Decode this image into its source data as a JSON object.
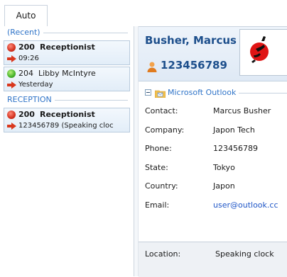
{
  "tabs": [
    {
      "label": "Auto"
    }
  ],
  "call_list": {
    "groups": [
      {
        "label": "(Recent)",
        "calls": [
          {
            "ext": "200",
            "name": "Receptionist",
            "detail": "09:26",
            "status": "busy"
          },
          {
            "ext": "204",
            "name": "Libby McIntyre",
            "detail": "Yesterday",
            "status": "available"
          }
        ]
      },
      {
        "label": "RECEPTION",
        "calls": [
          {
            "ext": "200",
            "name": "Receptionist",
            "detail": "123456789 (Speaking cloc",
            "status": "busy"
          }
        ]
      }
    ]
  },
  "contact_card": {
    "name": "Busher, Marcus",
    "number": "123456789",
    "source_label": "Microsoft Outlook",
    "fields": [
      {
        "key": "Contact:",
        "value": "Marcus Busher"
      },
      {
        "key": "Company:",
        "value": "Japon Tech"
      },
      {
        "key": "Phone:",
        "value": "123456789"
      },
      {
        "key": "State:",
        "value": "Tokyo"
      },
      {
        "key": "Country:",
        "value": "Japon"
      },
      {
        "key": "Email:",
        "value": "user@outlook.cc"
      }
    ],
    "location_key": "Location:",
    "location_value": "Speaking clock"
  },
  "colors": {
    "accent": "#2f74c8",
    "name_text": "#1d4f8c",
    "link": "#1f56c7",
    "busy": "#d3321f",
    "available": "#44b22a"
  },
  "icons": {
    "busy_status": "red-status-icon",
    "available_status": "green-status-icon",
    "call_direction": "call-arrow-icon",
    "person": "person-icon",
    "outlook": "outlook-icon",
    "collapse": "collapse-icon"
  }
}
